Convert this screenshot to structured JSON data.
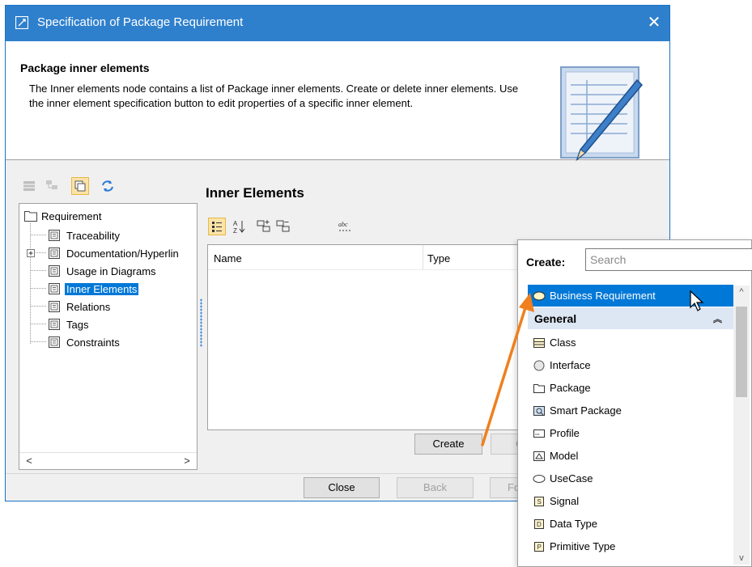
{
  "window": {
    "title": "Specification of Package Requirement"
  },
  "header": {
    "title": "Package inner elements",
    "description": "The Inner elements node contains a list of Package inner elements. Create or delete inner elements. Use the inner element specification button to edit properties of a specific inner element."
  },
  "tree": {
    "root": "Requirement",
    "items": [
      "Traceability",
      "Documentation/Hyperlin",
      "Usage in Diagrams",
      "Inner Elements",
      "Relations",
      "Tags",
      "Constraints"
    ],
    "selected": "Inner Elements"
  },
  "panel": {
    "title": "Inner Elements",
    "columns": {
      "name": "Name",
      "type": "Type"
    },
    "create_label": "Create",
    "partial_label": "C"
  },
  "footer": {
    "close": "Close",
    "back": "Back",
    "forward": "Fo"
  },
  "popup": {
    "create_label": "Create:",
    "search_placeholder": "Search",
    "highlighted": "Business Requirement",
    "group": "General",
    "items": [
      "Class",
      "Interface",
      "Package",
      "Smart Package",
      "Profile",
      "Model",
      "UseCase",
      "Signal",
      "Data Type",
      "Primitive Type"
    ]
  },
  "colors": {
    "titlebar": "#2f80cc",
    "selection": "#0078d7",
    "group_bg": "#dde6f3",
    "arrow": "#f07f1d"
  }
}
